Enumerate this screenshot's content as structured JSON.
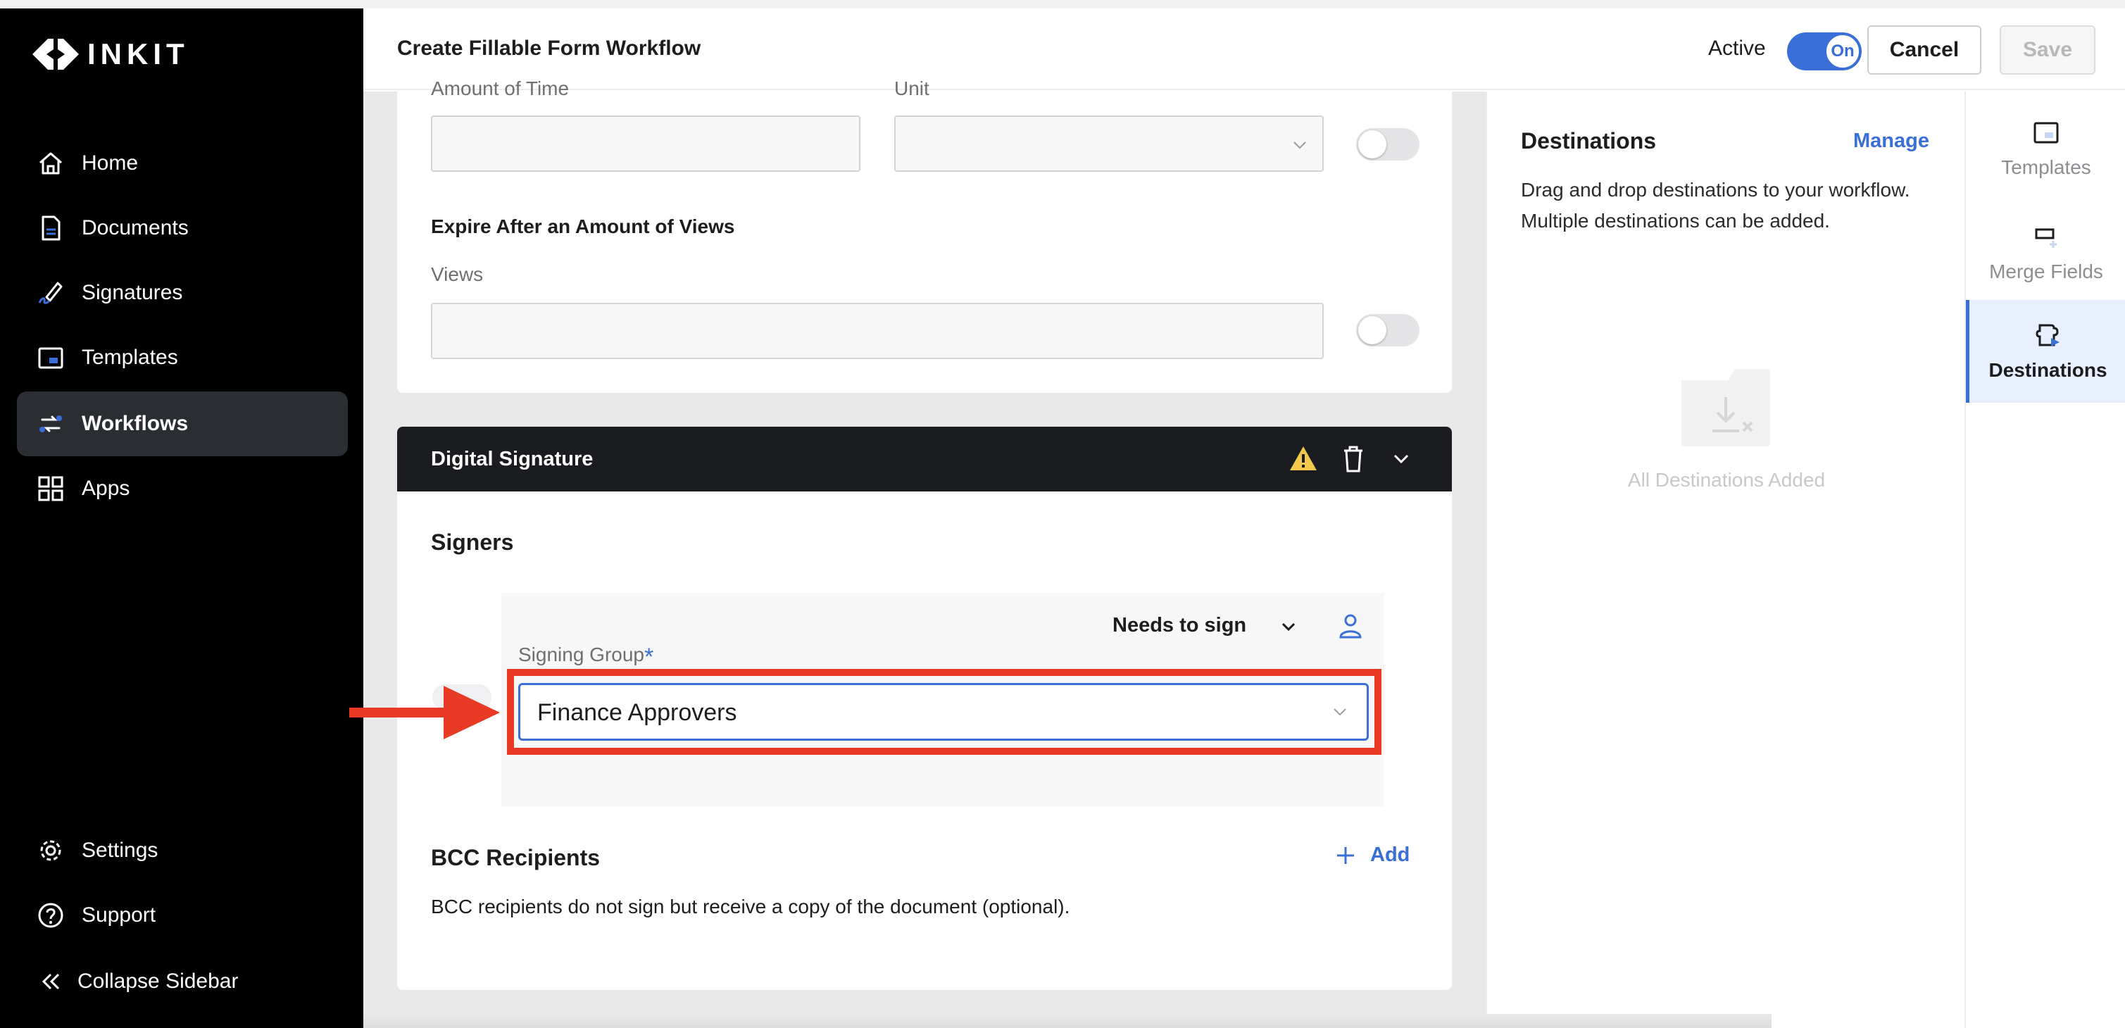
{
  "app": {
    "brand": "INKIT"
  },
  "sidebar": {
    "items": [
      {
        "label": "Home",
        "icon": "home-icon"
      },
      {
        "label": "Documents",
        "icon": "document-icon"
      },
      {
        "label": "Signatures",
        "icon": "signature-icon"
      },
      {
        "label": "Templates",
        "icon": "template-icon"
      },
      {
        "label": "Workflows",
        "icon": "workflow-icon",
        "active": true
      },
      {
        "label": "Apps",
        "icon": "apps-icon"
      }
    ],
    "bottom_items": [
      {
        "label": "Settings",
        "icon": "gear-icon"
      },
      {
        "label": "Support",
        "icon": "question-icon"
      },
      {
        "label": "Collapse Sidebar",
        "icon": "double-chevron-left-icon"
      }
    ]
  },
  "header": {
    "title": "Create Fillable Form Workflow",
    "active_label": "Active",
    "toggle_label": "On",
    "cancel_label": "Cancel",
    "save_label": "Save"
  },
  "expiration_card": {
    "amount_label": "Amount of Time",
    "unit_label": "Unit",
    "views_section_title": "Expire After an Amount of Views",
    "views_label": "Views"
  },
  "digital_signature": {
    "title": "Digital Signature",
    "signers_title": "Signers",
    "role": "Needs to sign",
    "signing_group_label": "Signing Group",
    "required_marker": "*",
    "signing_group_value": "Finance Approvers",
    "bcc_title": "BCC Recipients",
    "add_label": "Add",
    "bcc_description": "BCC recipients do not sign but receive a copy of the document (optional)."
  },
  "destinations": {
    "title": "Destinations",
    "manage_label": "Manage",
    "description": "Drag and drop destinations to your workflow. Multiple destinations can be added.",
    "empty_text": "All Destinations Added"
  },
  "rail": {
    "items": [
      {
        "label": "Templates",
        "icon": "template-icon"
      },
      {
        "label": "Merge Fields",
        "icon": "merge-fields-icon"
      },
      {
        "label": "Destinations",
        "icon": "destinations-icon",
        "active": true
      }
    ]
  },
  "colors": {
    "accent": "#3b6fd8",
    "highlight": "#e83a24",
    "warning": "#f2c94c"
  }
}
